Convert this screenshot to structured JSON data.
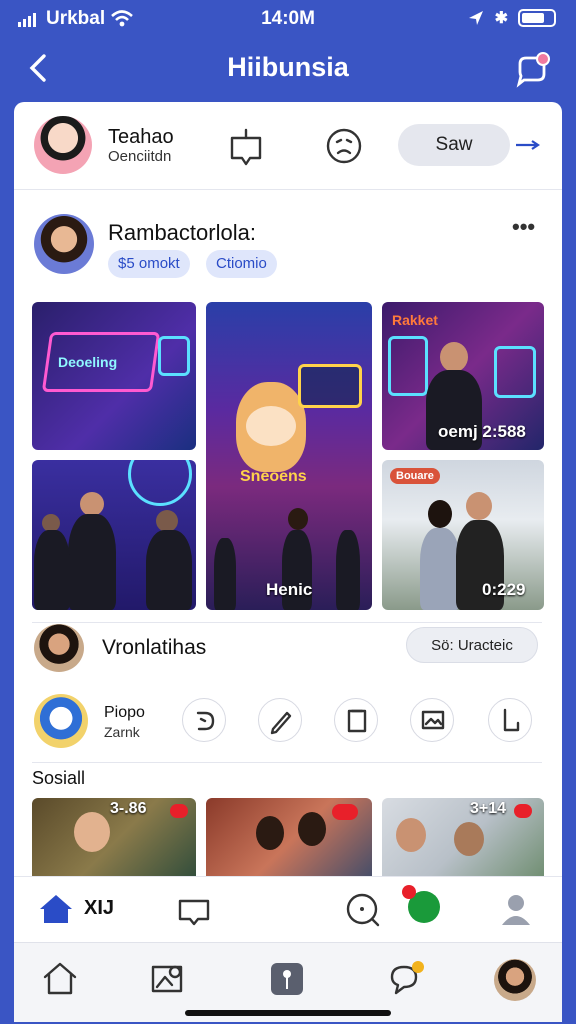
{
  "status": {
    "carrier": "Urkbal",
    "time": "14:0M"
  },
  "header": {
    "title": "Hiibunsia"
  },
  "profile_row": {
    "name": "Teahao",
    "subtitle": "Oenciitdn",
    "action_label": "Saw"
  },
  "post": {
    "author": "Rambactorlola:",
    "tags": [
      "$5 omokt",
      "Ctiomio"
    ],
    "media": [
      {
        "overlay": "Deoeling"
      },
      {
        "overlay": "Sneoens"
      },
      {
        "overlay": "Rakket"
      },
      {
        "caption": "Henic"
      },
      {
        "caption": "oemj 2:588"
      },
      {
        "caption": "0:229"
      },
      {
        "overlay": "Bouare"
      }
    ]
  },
  "friend_row": {
    "name": "Vronlatihas",
    "button_label": "Sö: Uracteic"
  },
  "user_row": {
    "name": "Piopo",
    "subtitle": "Zarnk"
  },
  "section": {
    "title": "Sosiall"
  },
  "thumbs": [
    {
      "caption": "3-.86"
    },
    {
      "caption": ""
    },
    {
      "caption": "3+14"
    }
  ],
  "tabbar": {
    "label": "XIJ"
  },
  "colors": {
    "brand": "#3a55c4",
    "accent": "#2a4cc7",
    "badge": "#e8202a"
  }
}
